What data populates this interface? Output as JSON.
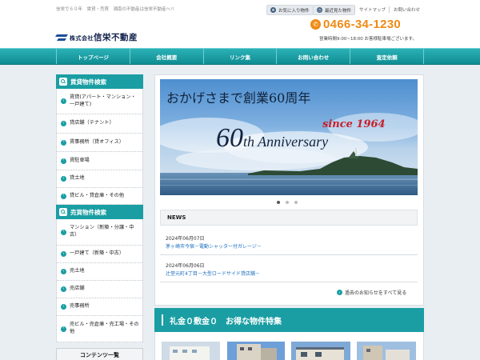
{
  "header": {
    "tagline": "信栄で６０年　賃貸・売買　湘南の不動産は信栄不動産へ!!",
    "company_prefix": "株式会社",
    "company_name": "信栄不動産",
    "favorites_label": "お気に入り物件",
    "recent_label": "最近見た物件",
    "sitemap_label": "サイトマップ",
    "contact_label": "お問い合わせ",
    "phone": "0466-34-1230",
    "hours": "営業時間9:00~18:00 お客様駐車場ございます。"
  },
  "nav": [
    "トップページ",
    "会社概要",
    "リンク集",
    "お問い合わせ",
    "査定依頼"
  ],
  "sidebar": {
    "rental_title": "賃貸物件検索",
    "rental_items": [
      "賃貸(アパート・マンション・一戸建て)",
      "貸店舗（テナント）",
      "賃事務所（貸オフィス）",
      "賃駐車場",
      "貸土地",
      "貸ビル・貸倉庫・その他"
    ],
    "sale_title": "売買物件検索",
    "sale_items": [
      "マンション（新築・分譲・中古）",
      "一戸建て（新築・中古）",
      "売土地",
      "売店舗",
      "売事務所",
      "売ビル・売倉庫・売工場・その他"
    ],
    "contents_title": "コンテンツ一覧"
  },
  "banner": {
    "headline": "おかげさまで創業60周年",
    "since": "since 1964",
    "anniversary_number": "60",
    "anniversary_text": "th Anniversary"
  },
  "news": {
    "title": "NEWS",
    "items": [
      {
        "date": "2024年06月07日",
        "text": "茅ヶ崎市今宿－電動シャッター付ガレージ－"
      },
      {
        "date": "2024年06月06日",
        "text": "辻堂元町4丁目－大型ロードサイド貸店舗－"
      }
    ],
    "all_link": "過去のお知らせをすべて見る"
  },
  "feature_title": "礼金０敷金０　お得な物件特集",
  "colors": {
    "teal": "#1a9ea3",
    "orange": "#f08a14",
    "navy": "#0f1f4a",
    "link": "#1a6fc0"
  }
}
